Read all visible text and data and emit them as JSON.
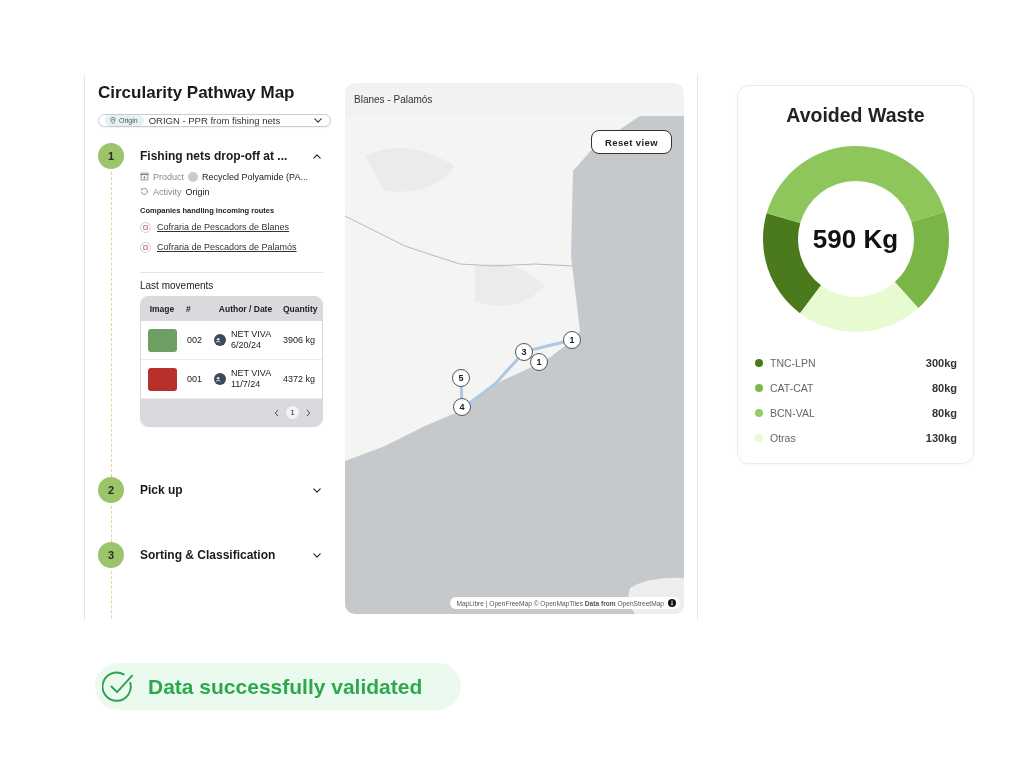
{
  "panel_title": "Circularity Pathway Map",
  "route_select": {
    "tag": "Origin",
    "value": "ORIGN - PPR from fishing nets"
  },
  "steps": [
    {
      "number": "1",
      "title": "Fishing nets drop-off at ...",
      "expanded": true,
      "details": [
        {
          "kind": "product",
          "label": "Product",
          "value": "Recycled Polyamide (PA..."
        },
        {
          "kind": "activity",
          "label": "Activity",
          "value": "Origin"
        }
      ],
      "companies_heading": "Companies handling incoming routes",
      "companies": [
        "Cofraria de Pescadors de Blanes",
        "Cofraria de Pescadors de Palamós"
      ],
      "movements": {
        "heading": "Last movements",
        "columns": [
          "Image",
          "#",
          "Author / Date",
          "Quantity"
        ],
        "rows": [
          {
            "number": "002",
            "author": "NET VIVA",
            "date": "6/20/24",
            "quantity": "3906 kg",
            "color": "#6f9f62"
          },
          {
            "number": "001",
            "author": "NET VIVA",
            "date": "11/7/24",
            "quantity": "4372 kg",
            "color": "#b8302c"
          }
        ],
        "pages": [
          {
            "label": "1",
            "selected": true
          }
        ]
      }
    },
    {
      "number": "2",
      "title": "Pick up",
      "expanded": false
    },
    {
      "number": "3",
      "title": "Sorting & Classification",
      "expanded": false
    }
  ],
  "map": {
    "title": "Blanes - Palamós",
    "reset_button": "Reset view",
    "markers": [
      "1",
      "3",
      "1",
      "5",
      "4"
    ],
    "attribution": "MapLibre | OpenFreeMap © OpenMapTiles **Data from** OpenStreetMap"
  },
  "avoided_waste": {
    "title": "Avoided Waste",
    "total": "590 Kg",
    "legend": [
      {
        "label": "TNC-LPN",
        "value": "300kg",
        "color": "#4a7a1b"
      },
      {
        "label": "CAT-CAT",
        "value": "80kg",
        "color": "#7cb94c"
      },
      {
        "label": "BCN-VAL",
        "value": "80kg",
        "color": "#97cb68"
      },
      {
        "label": "Otras",
        "value": "130kg",
        "color": "#e6fad3"
      }
    ]
  },
  "validation": {
    "message": "Data successfully validated"
  }
}
